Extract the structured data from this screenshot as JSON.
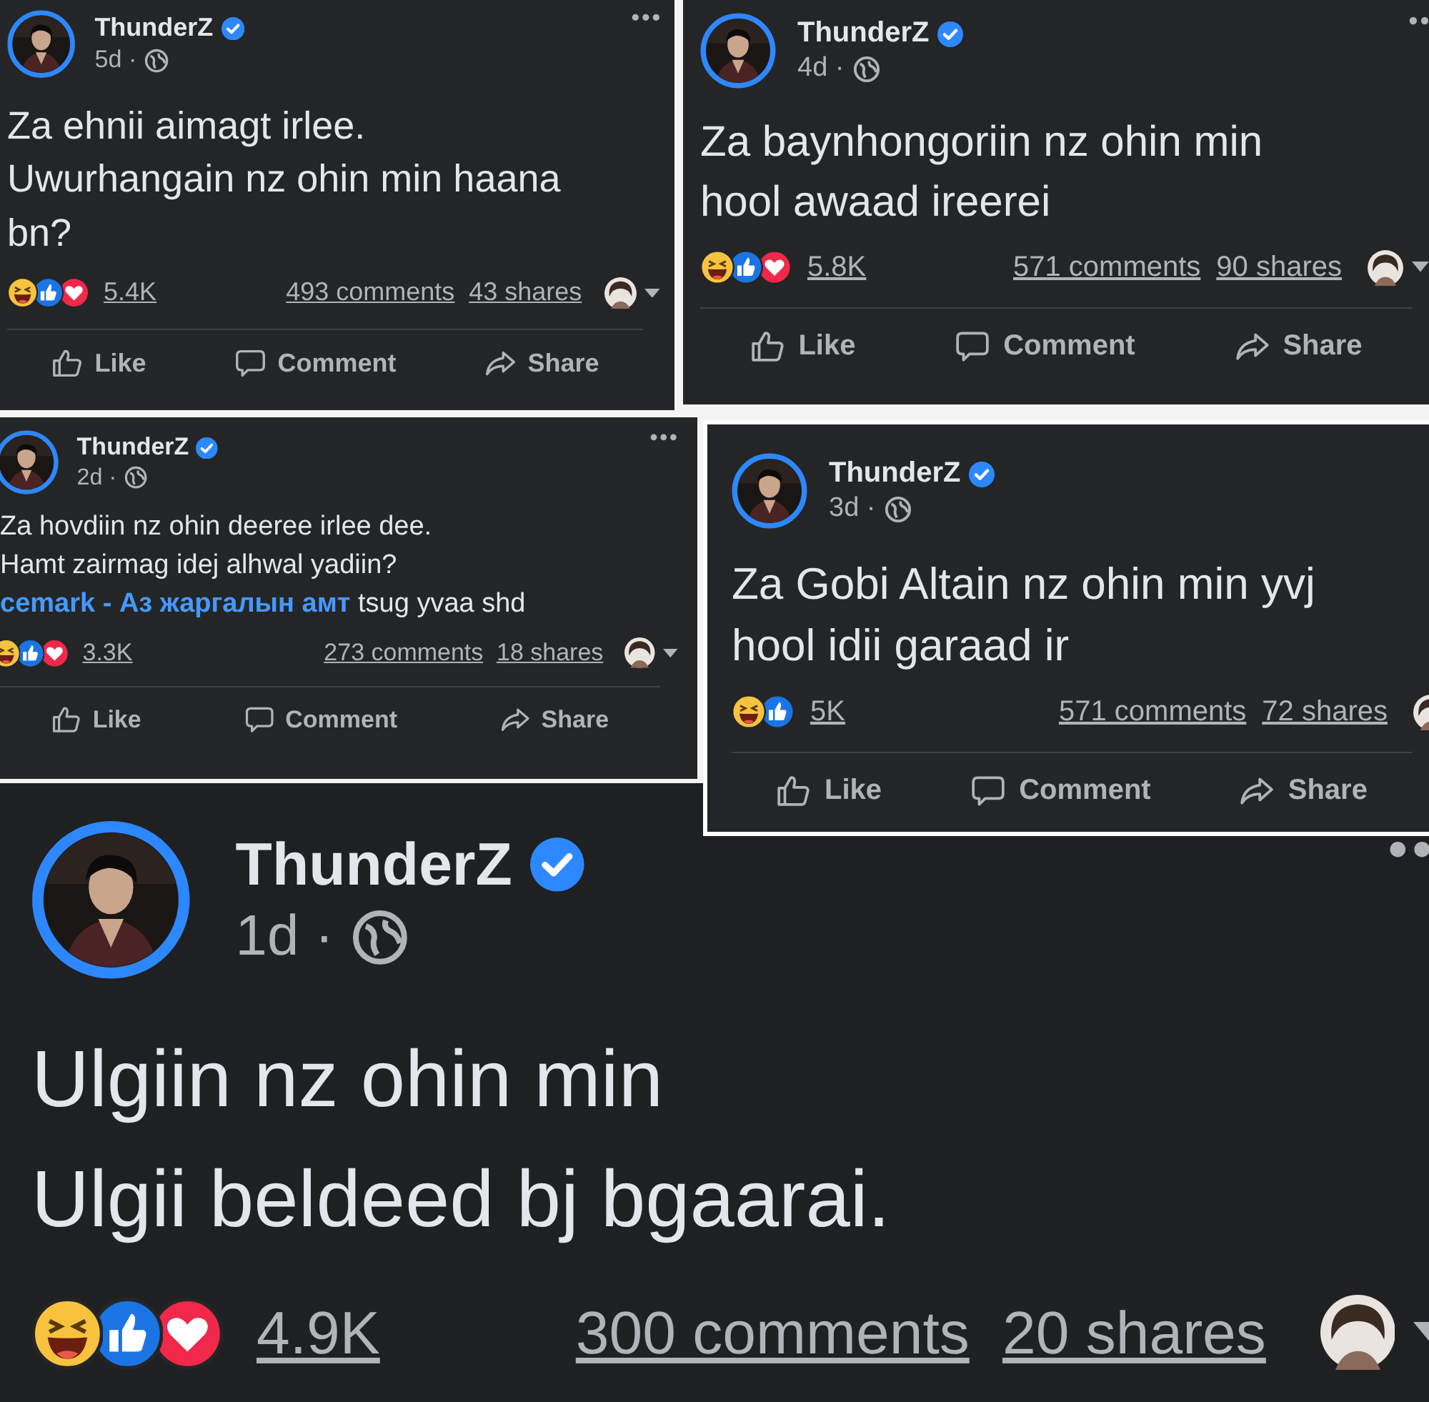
{
  "posts": [
    {
      "author": "ThunderZ",
      "time": "5d ·",
      "menu_visible": true,
      "lines": [
        [
          {
            "text": "Za ehnii aimagt irlee.",
            "kind": "plain"
          }
        ],
        [
          {
            "text": "Uwurhangain nz ohin min haana",
            "kind": "plain"
          }
        ],
        [
          {
            "text": "bn?",
            "kind": "plain"
          }
        ]
      ],
      "reactions": [
        {
          "kind": "haha"
        },
        {
          "kind": "like"
        },
        {
          "kind": "love"
        }
      ],
      "reaction_count": "5.4K",
      "comments": "493 comments",
      "shares": "43 shares",
      "actions": [
        {
          "kind": "like",
          "label": "Like"
        },
        {
          "kind": "comment",
          "label": "Comment"
        },
        {
          "kind": "share",
          "label": "Share"
        }
      ]
    },
    {
      "author": "ThunderZ",
      "time": "4d ·",
      "menu_visible": true,
      "lines": [
        [
          {
            "text": "Za baynhongoriin nz ohin min",
            "kind": "plain"
          }
        ],
        [
          {
            "text": "hool awaad ireerei",
            "kind": "plain"
          }
        ]
      ],
      "reactions": [
        {
          "kind": "haha"
        },
        {
          "kind": "like"
        },
        {
          "kind": "love"
        }
      ],
      "reaction_count": "5.8K",
      "comments": "571 comments",
      "shares": "90 shares",
      "actions": [
        {
          "kind": "like",
          "label": "Like"
        },
        {
          "kind": "comment",
          "label": "Comment"
        },
        {
          "kind": "share",
          "label": "Share"
        }
      ]
    },
    {
      "author": "ThunderZ",
      "time": "2d ·",
      "menu_visible": true,
      "lines": [
        [
          {
            "text": "Za hovdiin nz ohin deeree irlee dee.",
            "kind": "plain"
          }
        ],
        [
          {
            "text": "Hamt zairmag idej alhwal yadiin?",
            "kind": "plain"
          }
        ],
        [
          {
            "text": "cemark - Аз жаргалын амт",
            "kind": "link"
          },
          {
            "text": " tsug yvaa shd",
            "kind": "plain"
          }
        ]
      ],
      "reactions": [
        {
          "kind": "haha"
        },
        {
          "kind": "like"
        },
        {
          "kind": "love"
        }
      ],
      "reaction_count": "3.3K",
      "comments": "273 comments",
      "shares": "18 shares",
      "actions": [
        {
          "kind": "like",
          "label": "Like"
        },
        {
          "kind": "comment",
          "label": "Comment"
        },
        {
          "kind": "share",
          "label": "Share"
        }
      ]
    },
    {
      "author": "ThunderZ",
      "time": "3d ·",
      "menu_visible": false,
      "lines": [
        [
          {
            "text": "Za Gobi Altain nz ohin min yvj",
            "kind": "plain"
          }
        ],
        [
          {
            "text": "hool idii garaad ir",
            "kind": "plain"
          }
        ]
      ],
      "reactions": [
        {
          "kind": "haha"
        },
        {
          "kind": "like"
        }
      ],
      "reaction_count": "5K",
      "comments": "571 comments",
      "shares": "72 shares",
      "actions": [
        {
          "kind": "like",
          "label": "Like"
        },
        {
          "kind": "comment",
          "label": "Comment"
        },
        {
          "kind": "share",
          "label": "Share"
        }
      ]
    },
    {
      "author": "ThunderZ",
      "time": "1d ·",
      "menu_visible": true,
      "lines": [
        [
          {
            "text": "Ulgiin nz ohin min",
            "kind": "plain"
          }
        ],
        [
          {
            "text": "Ulgii beldeed bj bgaarai.",
            "kind": "plain"
          }
        ]
      ],
      "reactions": [
        {
          "kind": "haha"
        },
        {
          "kind": "like"
        },
        {
          "kind": "love"
        }
      ],
      "reaction_count": "4.9K",
      "comments": "300 comments",
      "shares": "20 shares"
    }
  ]
}
